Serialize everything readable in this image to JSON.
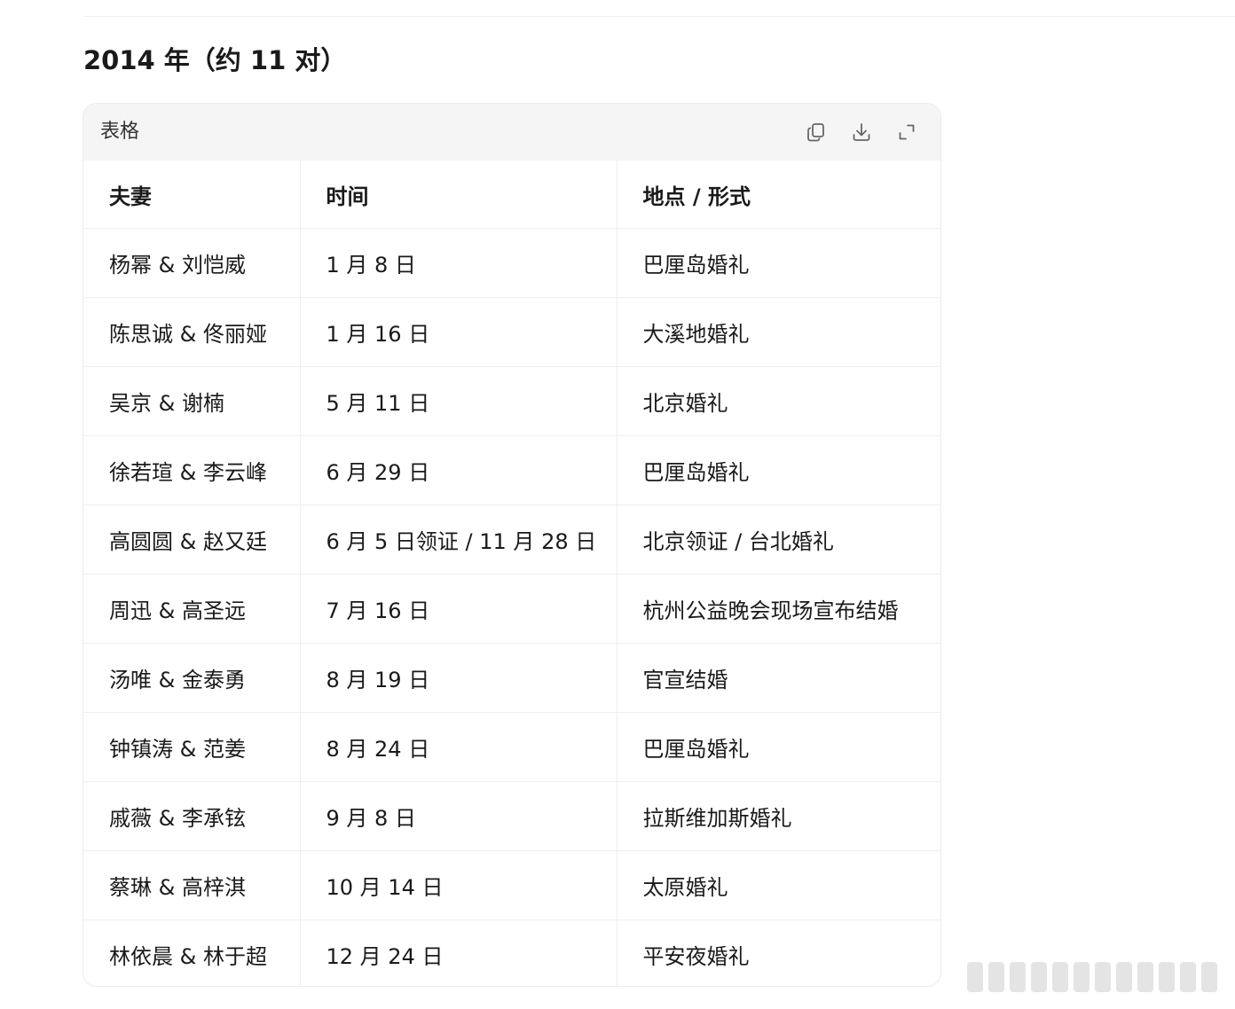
{
  "section": {
    "title": "2014 年（约 11 对）"
  },
  "table_card": {
    "title": "表格",
    "toolbar": {
      "copy_icon": "copy-icon",
      "download_icon": "download-icon",
      "expand_icon": "expand-icon"
    },
    "columns": [
      "夫妻",
      "时间",
      "地点 / 形式"
    ],
    "rows": [
      [
        "杨幂 & 刘恺威",
        "1 月 8 日",
        "巴厘岛婚礼"
      ],
      [
        "陈思诚 & 佟丽娅",
        "1 月 16 日",
        "大溪地婚礼"
      ],
      [
        "吴京 & 谢楠",
        "5 月 11 日",
        "北京婚礼"
      ],
      [
        "徐若瑄 & 李云峰",
        "6 月 29 日",
        "巴厘岛婚礼"
      ],
      [
        "高圆圆 & 赵又廷",
        "6 月 5 日领证 / 11 月 28 日",
        "北京领证 / 台北婚礼"
      ],
      [
        "周迅 & 高圣远",
        "7 月 16 日",
        "杭州公益晚会现场宣布结婚"
      ],
      [
        "汤唯 & 金泰勇",
        "8 月 19 日",
        "官宣结婚"
      ],
      [
        "钟镇涛 & 范姜",
        "8 月 24 日",
        "巴厘岛婚礼"
      ],
      [
        "戚薇 & 李承铉",
        "9 月 8 日",
        "拉斯维加斯婚礼"
      ],
      [
        "蔡琳 & 高梓淇",
        "10 月 14 日",
        "太原婚礼"
      ],
      [
        "林依晨 & 林于超",
        "12 月 24 日",
        "平安夜婚礼"
      ]
    ]
  },
  "colors": {
    "header_bg": "#f5f5f5",
    "border": "#efefef",
    "text": "#1a1a1a",
    "icon": "#666666"
  }
}
